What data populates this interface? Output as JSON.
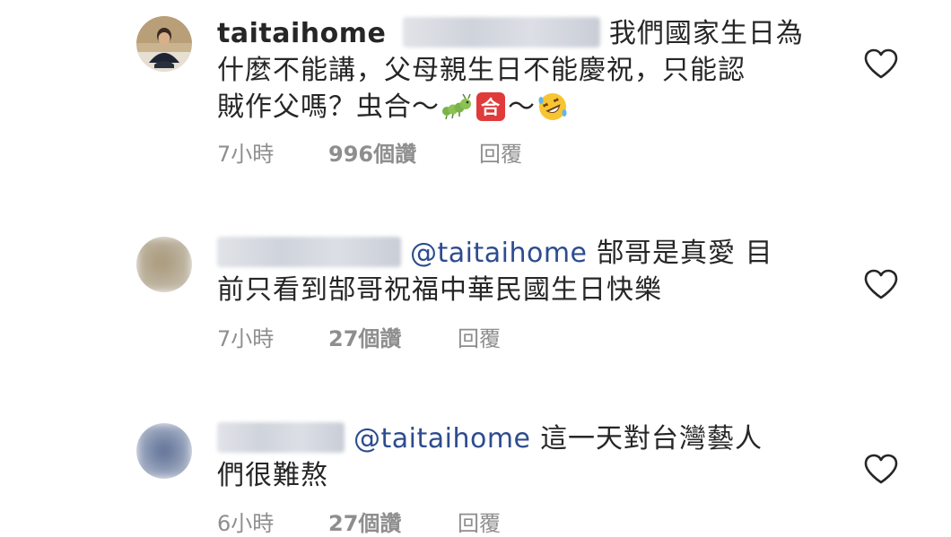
{
  "comments": [
    {
      "username": "taitaihome",
      "mention": "",
      "text_line1": "我們國家生日為",
      "text_line2": "什麼不能講，父母親生日不能慶祝，只能認",
      "text_line3a": "賊作父嗎？虫合～",
      "text_line3b": "～",
      "time": "7小時",
      "likes": "996個讚",
      "reply": "回覆",
      "emoji": [
        "bug-emoji",
        "he-character-emoji",
        "rolling-laughing-emoji"
      ],
      "icon": "heart-outline-icon"
    },
    {
      "username": "",
      "mention": "@taitaihome",
      "text_line1": "郜哥是真愛 目",
      "text_line2": "前只看到郜哥祝福中華民國生日快樂",
      "time": "7小時",
      "likes": "27個讚",
      "reply": "回覆",
      "icon": "heart-outline-icon"
    },
    {
      "username": "",
      "mention": "@taitaihome",
      "text_line1": "這一天對台灣藝人",
      "text_line2": "們很難熬",
      "time": "6小時",
      "likes": "27個讚",
      "reply": "回覆",
      "icon": "heart-outline-icon"
    }
  ],
  "colors": {
    "text": "#262626",
    "mention": "#2d4c8f",
    "meta": "#8e8e8e",
    "heart": "#262626"
  }
}
